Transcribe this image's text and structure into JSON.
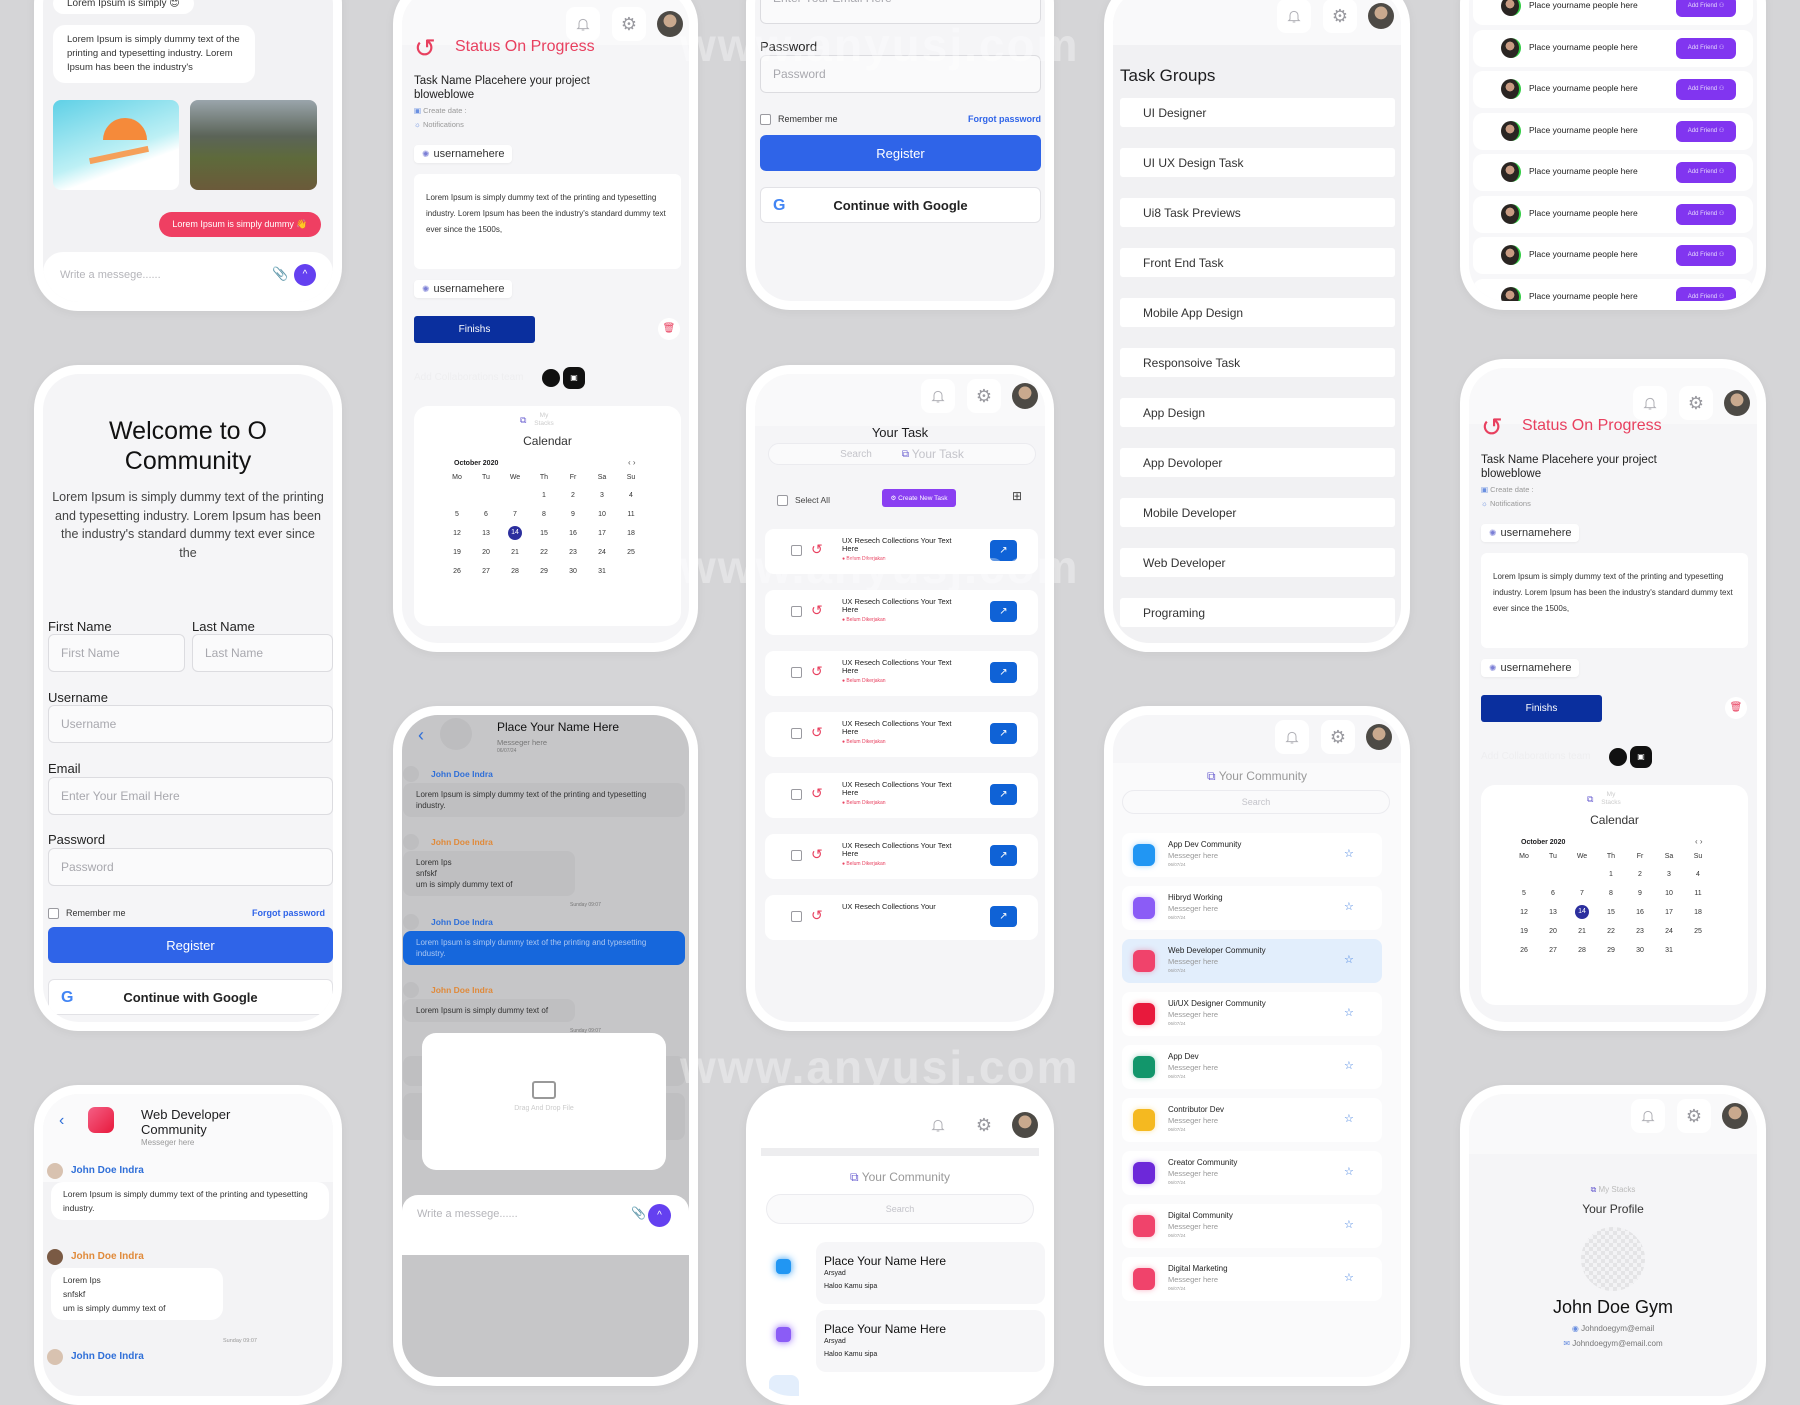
{
  "watermark": "www.anyusj.com",
  "common": {
    "bell_icon": "bell-icon",
    "gear_icon": "gear-icon",
    "send_icon": "chevron-up-icon",
    "attach_icon": "paperclip-icon"
  },
  "colors": {
    "primary_blue": "#2f64e8",
    "navy": "#0a2f9e",
    "purple": "#7c3aed",
    "pink": "#e8405f",
    "send": "#6440f0",
    "background": "#d5d5d7"
  },
  "chat_top": {
    "bubble_top": "Lorem Ipsum is simply 😊",
    "bubble_text": "Lorem Ipsum is simply dummy text of the printing and typesetting industry. Lorem Ipsum has been the industry's",
    "pink_bubble": "Lorem Ipsum is simply dummy 👋",
    "input_placeholder": "Write a messege......"
  },
  "register": {
    "title": "Welcome to O Community",
    "description": "Lorem Ipsum is simply dummy text of the printing and typesetting industry. Lorem Ipsum has been the industry's standard dummy text ever since the",
    "first_name_label": "First Name",
    "first_name_placeholder": "First Name",
    "last_name_label": "Last Name",
    "last_name_placeholder": "Last Name",
    "username_label": "Username",
    "username_placeholder": "Username",
    "email_label": "Email",
    "email_placeholder": "Enter Your Email Here",
    "password_label": "Password",
    "password_placeholder": "Password",
    "remember_me": "Remember me",
    "forgot_password": "Forgot password",
    "register_button": "Register",
    "google_button": "Continue with Google"
  },
  "group_chat": {
    "title": "Web Developer Community",
    "subtitle": "Messeger here",
    "messages": [
      {
        "name": "John Doe Indra",
        "color": "blue",
        "text": "Lorem Ipsum is simply dummy text of the printing and typesetting industry."
      },
      {
        "name": "John Doe Indra",
        "color": "orange",
        "text": "Lorem Ips\nsnfskf\num is simply dummy text of"
      },
      {
        "name": "John Doe Indra",
        "color": "blue",
        "text": ""
      }
    ],
    "timestamp": "Sunday 09:07"
  },
  "status": {
    "title": "Status On Progress",
    "task_name": "Task Name Placehere your project bloweblowe",
    "create_date_label": "Create date :",
    "notifications_label": "Notifications",
    "username_chip": "usernamehere",
    "description": "Lorem Ipsum is simply dummy text of the printing and typesetting industry. Lorem Ipsum has been the industry's standard dummy text ever since the 1500s,",
    "finish_button": "Finishs",
    "collab_label": "Add Collaborations team",
    "stacks_label": "My Stacks",
    "calendar_title": "Calendar"
  },
  "calendar": {
    "month": "October 2020",
    "weekdays": [
      "Mo",
      "Tu",
      "We",
      "Th",
      "Fr",
      "Sa",
      "Su"
    ],
    "weeks": [
      [
        "",
        "",
        "",
        "1",
        "2",
        "3",
        "4"
      ],
      [
        "5",
        "6",
        "7",
        "8",
        "9",
        "10",
        "11"
      ],
      [
        "12",
        "13",
        "14",
        "15",
        "16",
        "17",
        "18"
      ],
      [
        "19",
        "20",
        "21",
        "22",
        "23",
        "24",
        "25"
      ],
      [
        "26",
        "27",
        "28",
        "29",
        "30",
        "31",
        ""
      ]
    ],
    "selected": "14"
  },
  "private_chat": {
    "title": "Place Your Name Here",
    "subtitle": "Messeger here",
    "date": "06/07/24",
    "messages": [
      {
        "name": "John Doe Indra",
        "color": "blue",
        "text": "Lorem Ipsum is simply dummy text of the printing and typesetting industry.",
        "highlight": false
      },
      {
        "name": "John Doe Indra",
        "color": "orange",
        "text": "Lorem Ips\nsnfskf\num is simply dummy text of",
        "highlight": false
      },
      {
        "name": "John Doe Indra",
        "color": "blue",
        "text": "Lorem Ipsum is simply dummy text of the printing and typesetting industry.",
        "highlight": true
      },
      {
        "name": "John Doe Indra",
        "color": "orange",
        "text": "Lorem Ipsum is simply dummy text of",
        "highlight": false
      }
    ],
    "timestamp": "Sunday 09:07",
    "dropzone_label": "Drag And Drop File",
    "input_placeholder": "Write a messege......"
  },
  "tasks": {
    "title": "Your Task",
    "search_placeholder": "Search",
    "search_hint": "Your Task",
    "select_all": "Select All",
    "create_button": "Create New Task",
    "items": [
      {
        "title": "UX Resech Collections Your Text Here",
        "status": "Belum Dikerjakan"
      },
      {
        "title": "UX Resech Collections Your Text Here",
        "status": "Belum Dikerjakan"
      },
      {
        "title": "UX Resech Collections Your Text Here",
        "status": "Belum Dikerjakan"
      },
      {
        "title": "UX Resech Collections Your Text Here",
        "status": "Belum Dikerjakan"
      },
      {
        "title": "UX Resech Collections Your Text Here",
        "status": "Belum Dikerjakan"
      },
      {
        "title": "UX Resech Collections Your Text Here",
        "status": "Belum Dikerjakan"
      },
      {
        "title": "UX Resech Collections Your",
        "status": ""
      }
    ]
  },
  "community_small": {
    "title": "Your Community",
    "search_placeholder": "Search",
    "items": [
      {
        "name": "Place Your Name Here",
        "sender": "Arsyad",
        "message": "Haloo Kamu sipa",
        "color": "#2196f3"
      },
      {
        "name": "Place Your Name Here",
        "sender": "Arsyad",
        "message": "Haloo Kamu sipa",
        "color": "#8b5cf6"
      }
    ]
  },
  "task_groups": {
    "title": "Task Groups",
    "items": [
      "UI Designer",
      "UI UX Design Task",
      "Ui8 Task Previews",
      "Front End Task",
      "Mobile App Design",
      "Responsoive Task",
      "App Design",
      "App Devoloper",
      "Mobile Developer",
      "Web Developer",
      "Programing"
    ]
  },
  "community": {
    "title": "Your Community",
    "search_placeholder": "Search",
    "items": [
      {
        "name": "App Dev Community",
        "message": "Messeger here",
        "date": "06/07/24",
        "color": "#2196f3",
        "active": false
      },
      {
        "name": "Hibryd Working",
        "message": "Messeger here",
        "date": "06/07/24",
        "color": "#8b5cf6",
        "active": false
      },
      {
        "name": "Web Developer Community",
        "message": "Messeger here",
        "date": "06/07/24",
        "color": "#f0436b",
        "active": true
      },
      {
        "name": "Ui/UX Designer Community",
        "message": "Messeger here",
        "date": "06/07/24",
        "color": "#e8193c",
        "active": false
      },
      {
        "name": "App Dev",
        "message": "Messeger here",
        "date": "06/07/24",
        "color": "#12966b",
        "active": false
      },
      {
        "name": "Contributor Dev",
        "message": "Messeger here",
        "date": "06/07/24",
        "color": "#f5b920",
        "active": false
      },
      {
        "name": "Creator Community",
        "message": "Messeger here",
        "date": "06/07/24",
        "color": "#6d28d9",
        "active": false
      },
      {
        "name": "Digital Community",
        "message": "Messeger here",
        "date": "06/07/24",
        "color": "#f0436b",
        "active": false
      },
      {
        "name": "Digital Marketing",
        "message": "Messeger here",
        "date": "06/07/24",
        "color": "#f0436b",
        "active": false
      }
    ]
  },
  "friends": {
    "button_label": "Add Friend",
    "items": [
      "Place yourname people here",
      "Place yourname people here",
      "Place yourname people here",
      "Place yourname people here",
      "Place yourname people here",
      "Place yourname people here",
      "Place yourname people here",
      "Place yourname people here"
    ]
  },
  "profile": {
    "stacks_label": "My Stacks",
    "title": "Your Profile",
    "name": "John Doe Gym",
    "username": "Johndoegym@email",
    "email": "Johndoegym@email.com"
  }
}
